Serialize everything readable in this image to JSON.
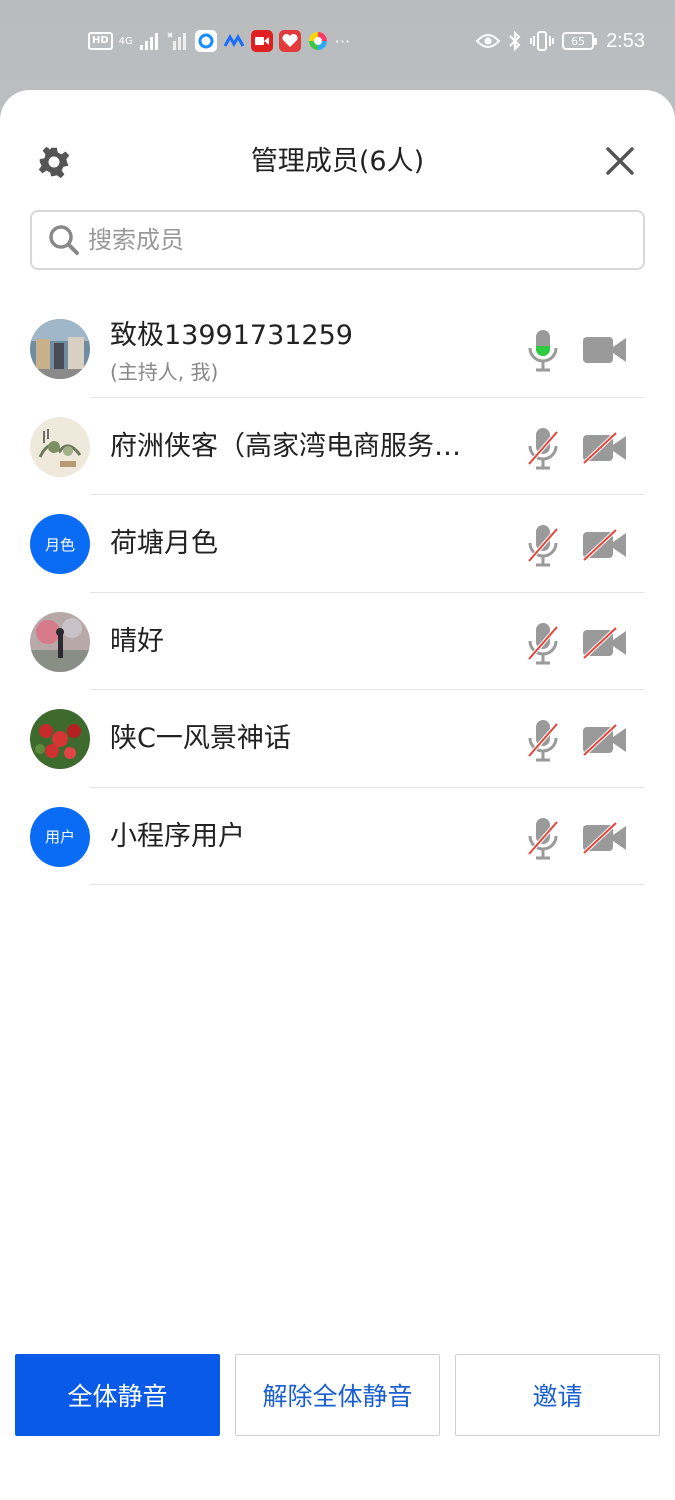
{
  "status_bar": {
    "hd": "HD",
    "net": "4G",
    "battery": "65",
    "time": "2:53",
    "more": "···"
  },
  "header": {
    "title": "管理成员(6人)"
  },
  "search": {
    "placeholder": "搜索成员"
  },
  "members": [
    {
      "name": "致极13991731259",
      "subtitle": "(主持人, 我)",
      "avatar_text": "",
      "mic": "on",
      "camera": "off"
    },
    {
      "name": "府洲侠客（高家湾电商服务…",
      "subtitle": "",
      "avatar_text": "",
      "mic": "muted",
      "camera": "disabled"
    },
    {
      "name": "荷塘月色",
      "subtitle": "",
      "avatar_text": "月色",
      "mic": "muted",
      "camera": "disabled"
    },
    {
      "name": "晴好",
      "subtitle": "",
      "avatar_text": "",
      "mic": "muted",
      "camera": "disabled"
    },
    {
      "name": "陕C一风景神话",
      "subtitle": "",
      "avatar_text": "",
      "mic": "muted",
      "camera": "disabled"
    },
    {
      "name": "小程序用户",
      "subtitle": "",
      "avatar_text": "用户",
      "mic": "muted",
      "camera": "disabled"
    }
  ],
  "actions": {
    "mute_all": "全体静音",
    "unmute_all": "解除全体静音",
    "invite": "邀请"
  },
  "colors": {
    "primary": "#0a5ae8",
    "avatar_blue": "#0a6cf5",
    "mic_on": "#2ecc40",
    "muted_slash": "#e0463c",
    "icon_gray": "#9a9a9a"
  }
}
